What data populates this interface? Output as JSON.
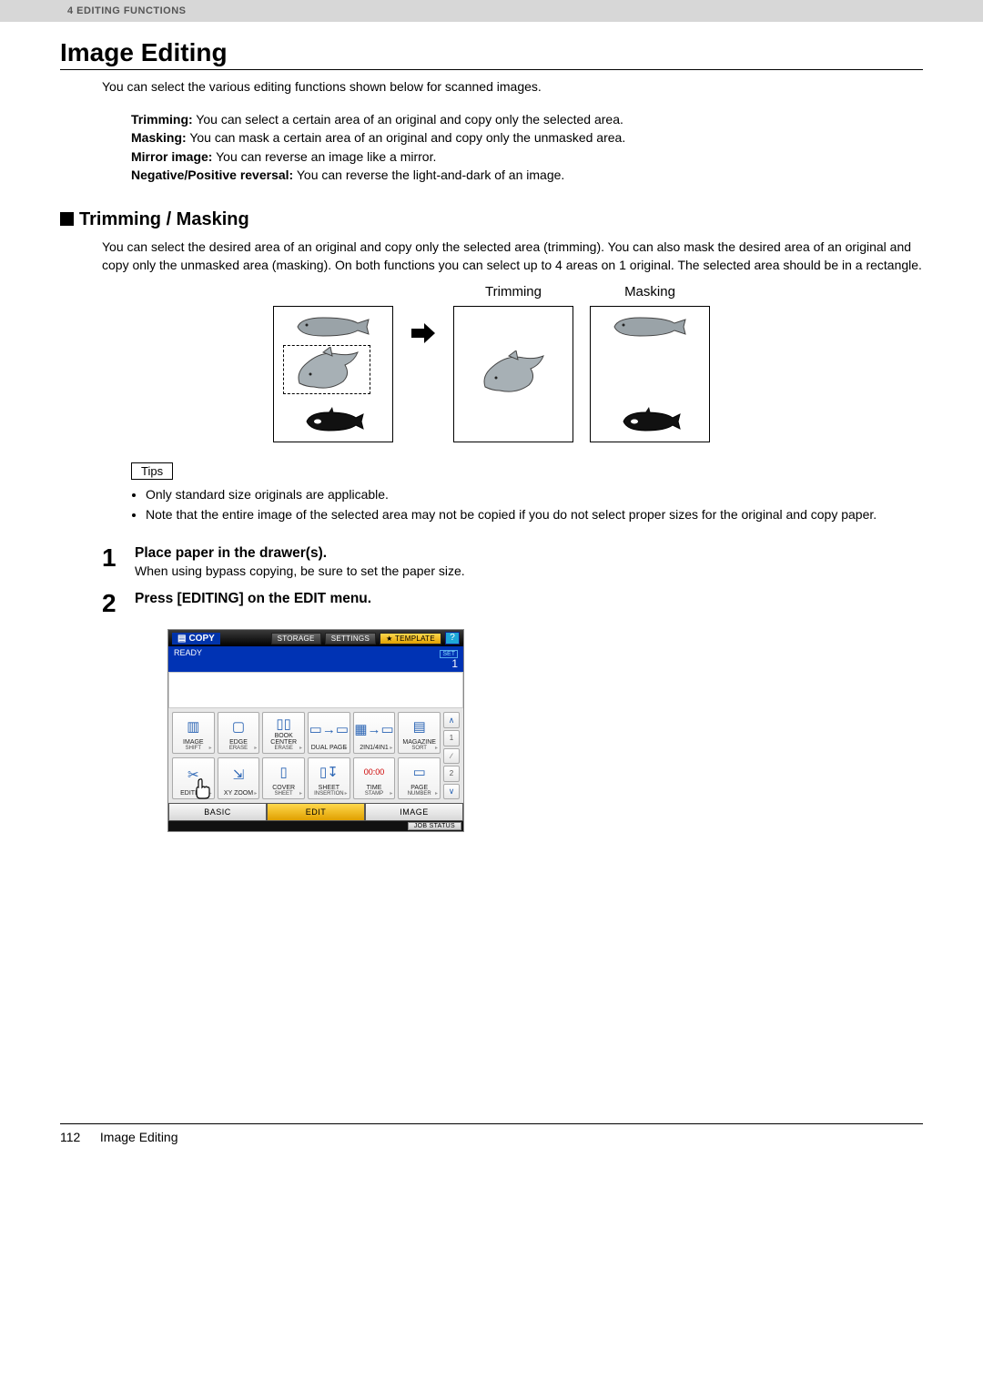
{
  "header": {
    "breadcrumb": "4 EDITING FUNCTIONS"
  },
  "title": "Image Editing",
  "intro": "You can select the various editing functions shown below for scanned images.",
  "defs": {
    "trimming_label": "Trimming:",
    "trimming_text": " You can select a certain area of an original and copy only the selected area.",
    "masking_label": "Masking:",
    "masking_text": " You can mask a certain area of an original and copy only the unmasked area.",
    "mirror_label": "Mirror image:",
    "mirror_text": " You can reverse an image like a mirror.",
    "negpos_label": "Negative/Positive reversal:",
    "negpos_text": " You can reverse the light-and-dark of an image."
  },
  "section_trimmask": {
    "heading": "Trimming / Masking",
    "body": "You can select the desired area of an original and copy only the selected area (trimming). You can also mask the desired area of an original and copy only the unmasked area (masking). On both functions you can select up to 4 areas on 1 original. The selected area should be in a rectangle.",
    "trimming_label": "Trimming",
    "masking_label": "Masking"
  },
  "tips": {
    "label": "Tips",
    "items": [
      "Only standard size originals are applicable.",
      "Note that the entire image of the selected area may not be copied if you do not select proper sizes for the original and copy paper."
    ]
  },
  "steps": [
    {
      "num": "1",
      "title": "Place paper in the drawer(s).",
      "desc": "When using bypass copying, be sure to set the paper size."
    },
    {
      "num": "2",
      "title": "Press [EDITING] on the EDIT menu.",
      "desc": ""
    }
  ],
  "ui": {
    "copy": "COPY",
    "storage": "STORAGE",
    "settings": "SETTINGS",
    "template": "TEMPLATE",
    "help": "?",
    "ready": "READY",
    "set_label": "SET",
    "set_value": "1",
    "buttons_row1": [
      {
        "label": "IMAGE",
        "sub": "SHIFT"
      },
      {
        "label": "EDGE",
        "sub": "ERASE"
      },
      {
        "label": "BOOK CENTER",
        "sub": "ERASE"
      },
      {
        "label": "DUAL PAGE",
        "sub": ""
      },
      {
        "label": "2IN1/4IN1",
        "sub": ""
      },
      {
        "label": "MAGAZINE",
        "sub": "SORT"
      }
    ],
    "buttons_row2": [
      {
        "label": "EDITING",
        "sub": ""
      },
      {
        "label": "XY ZOOM",
        "sub": ""
      },
      {
        "label": "COVER",
        "sub": "SHEET"
      },
      {
        "label": "SHEET",
        "sub": "INSERTION"
      },
      {
        "label": "TIME",
        "sub": "STAMP",
        "extra": "00:00"
      },
      {
        "label": "PAGE",
        "sub": "NUMBER"
      }
    ],
    "side": {
      "page_current": "1",
      "divider": "∕",
      "page_total": "2"
    },
    "tabs": [
      "BASIC",
      "EDIT",
      "IMAGE"
    ],
    "active_tab": 1,
    "jobstatus": "JOB STATUS"
  },
  "footer": {
    "page": "112",
    "title": "Image Editing"
  }
}
